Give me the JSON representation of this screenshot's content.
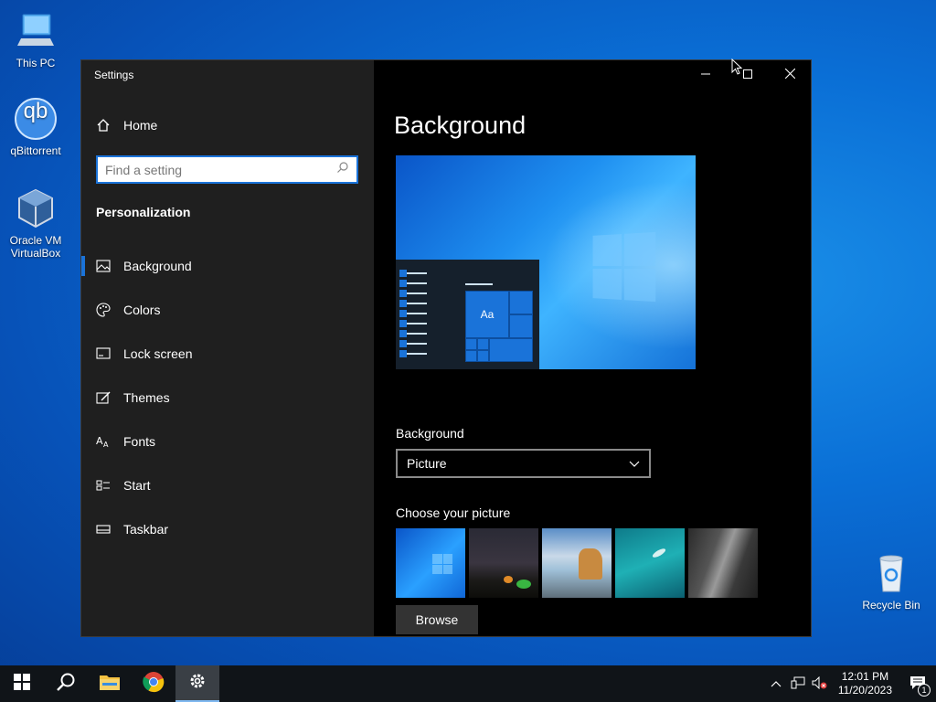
{
  "desktop": {
    "icons": [
      {
        "label": "This PC",
        "icon": "computer-icon"
      },
      {
        "label": "qBittorrent",
        "icon": "qbittorrent-icon",
        "glyph": "qb"
      },
      {
        "label": "Oracle VM VirtualBox",
        "icon": "virtualbox-icon"
      }
    ],
    "recycle_bin": {
      "label": "Recycle Bin",
      "icon": "recycle-bin-icon"
    }
  },
  "window": {
    "title": "Settings",
    "controls": {
      "minimize": "minimize-icon",
      "maximize": "maximize-icon",
      "close": "close-icon"
    }
  },
  "sidebar": {
    "home_label": "Home",
    "search_placeholder": "Find a setting",
    "section_heading": "Personalization",
    "items": [
      {
        "label": "Background",
        "icon": "picture-icon",
        "active": true
      },
      {
        "label": "Colors",
        "icon": "palette-icon",
        "active": false
      },
      {
        "label": "Lock screen",
        "icon": "lock-screen-icon",
        "active": false
      },
      {
        "label": "Themes",
        "icon": "themes-icon",
        "active": false
      },
      {
        "label": "Fonts",
        "icon": "fonts-icon",
        "active": false
      },
      {
        "label": "Start",
        "icon": "start-icon",
        "active": false
      },
      {
        "label": "Taskbar",
        "icon": "taskbar-icon",
        "active": false
      }
    ]
  },
  "main": {
    "page_title": "Background",
    "preview_tile_text": "Aa",
    "background_label": "Background",
    "background_value": "Picture",
    "choose_label": "Choose your picture",
    "browse_label": "Browse"
  },
  "taskbar": {
    "apps": [
      "start-icon",
      "search-icon",
      "file-explorer-icon",
      "chrome-icon",
      "settings-icon"
    ],
    "clock_time": "12:01 PM",
    "clock_date": "11/20/2023",
    "notification_count": "1"
  },
  "colors": {
    "accent": "#1a73d9",
    "sidebar": "#1f1f1f",
    "content": "#000000"
  }
}
